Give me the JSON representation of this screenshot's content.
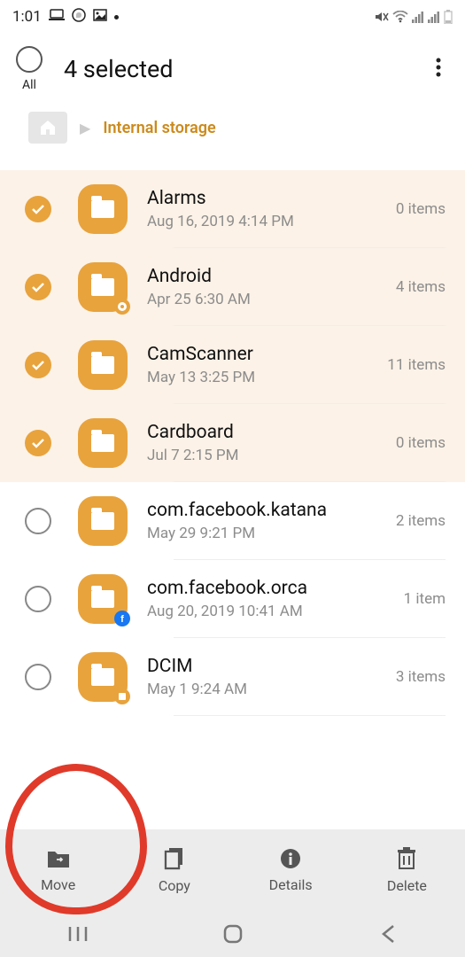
{
  "statusbar": {
    "time": "1:01"
  },
  "header": {
    "title": "4 selected",
    "all_label": "All"
  },
  "breadcrumb": {
    "location": "Internal storage"
  },
  "files": [
    {
      "name": "Alarms",
      "date": "Aug 16, 2019 4:14 PM",
      "count": "0 items",
      "selected": true,
      "badge": null
    },
    {
      "name": "Android",
      "date": "Apr 25 6:30 AM",
      "count": "4 items",
      "selected": true,
      "badge": "gear"
    },
    {
      "name": "CamScanner",
      "date": "May 13 3:25 PM",
      "count": "11 items",
      "selected": true,
      "badge": null
    },
    {
      "name": "Cardboard",
      "date": "Jul 7 2:15 PM",
      "count": "0 items",
      "selected": true,
      "badge": null
    },
    {
      "name": "com.facebook.katana",
      "date": "May 29 9:21 PM",
      "count": "2 items",
      "selected": false,
      "badge": null
    },
    {
      "name": "com.facebook.orca",
      "date": "Aug 20, 2019 10:41 AM",
      "count": "1 item",
      "selected": false,
      "badge": "fb"
    },
    {
      "name": "DCIM",
      "date": "May 1 9:24 AM",
      "count": "3 items",
      "selected": false,
      "badge": "sd"
    }
  ],
  "actions": {
    "move": "Move",
    "copy": "Copy",
    "details": "Details",
    "delete": "Delete"
  }
}
